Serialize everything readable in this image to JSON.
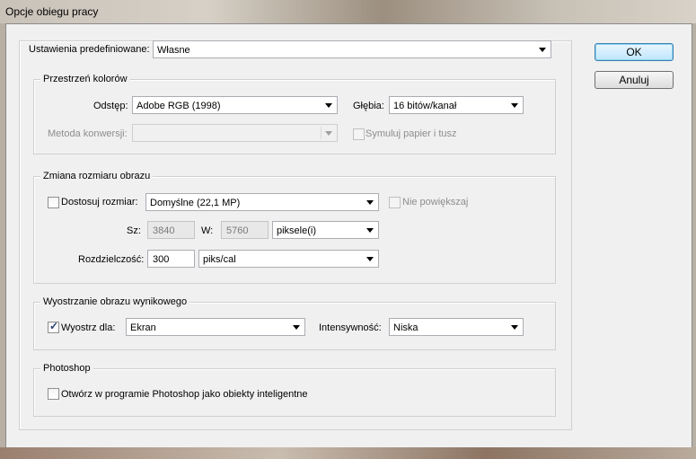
{
  "window": {
    "title": "Opcje obiegu pracy"
  },
  "preset": {
    "label": "Ustawienia predefiniowane:",
    "value": "Własne"
  },
  "buttons": {
    "ok": "OK",
    "cancel": "Anuluj"
  },
  "color_space": {
    "legend": "Przestrzeń kolorów",
    "space_label": "Odstęp:",
    "space_value": "Adobe RGB (1998)",
    "depth_label": "Głębia:",
    "depth_value": "16 bitów/kanał",
    "method_label": "Metoda konwersji:",
    "method_value": "",
    "simulate_label": "Symuluj papier i tusz"
  },
  "resize": {
    "legend": "Zmiana rozmiaru obrazu",
    "fit_label": "Dostosuj rozmiar:",
    "fit_value": "Domyślne (22,1 MP)",
    "no_enlarge_label": "Nie powiększaj",
    "w_label": "Sz:",
    "w_value": "3840",
    "h_label": "W:",
    "h_value": "5760",
    "unit_value": "piksele(i)",
    "res_label": "Rozdzielczość:",
    "res_value": "300",
    "res_unit": "piks/cal"
  },
  "sharpen": {
    "legend": "Wyostrzanie obrazu wynikowego",
    "sharpen_label": "Wyostrz dla:",
    "sharpen_value": "Ekran",
    "amount_label": "Intensywność:",
    "amount_value": "Niska"
  },
  "photoshop": {
    "legend": "Photoshop",
    "smart_label": "Otwórz w programie Photoshop jako obiekty inteligentne"
  }
}
